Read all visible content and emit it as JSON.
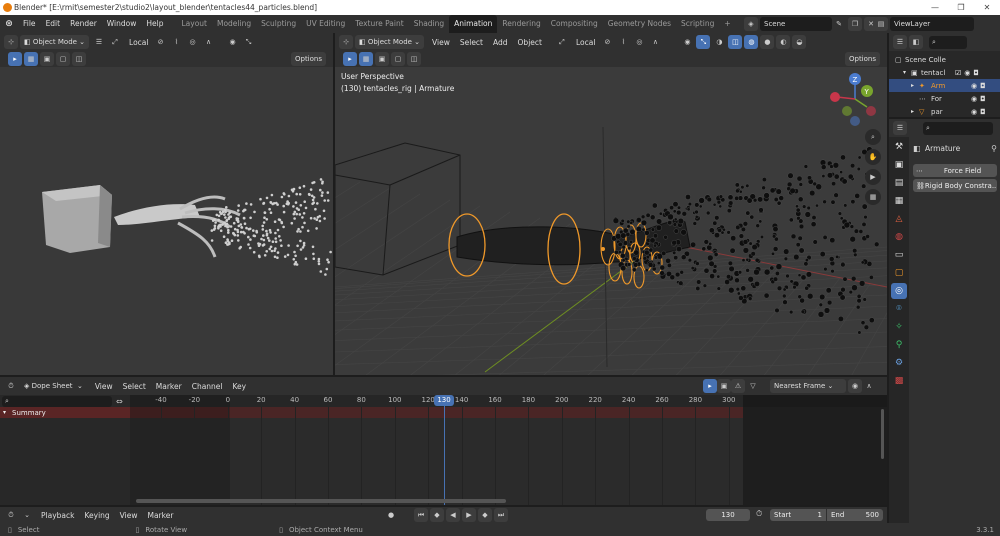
{
  "window": {
    "title": "Blender* [E:\\rmit\\semester2\\studio2\\layout_blender\\tentacles44_particles.blend]"
  },
  "menu": {
    "items": [
      "File",
      "Edit",
      "Render",
      "Window",
      "Help"
    ]
  },
  "workspaces": [
    "Layout",
    "Modeling",
    "Sculpting",
    "UV Editing",
    "Texture Paint",
    "Shading",
    "Animation",
    "Rendering",
    "Compositing",
    "Geometry Nodes",
    "Scripting"
  ],
  "active_workspace": "Animation",
  "scene": {
    "name": "Scene",
    "view_layer": "ViewLayer"
  },
  "left_viewport": {
    "mode": "Object Mode",
    "orientation": "Local",
    "options": "Options"
  },
  "main_viewport": {
    "mode": "Object Mode",
    "menu": [
      "View",
      "Select",
      "Add",
      "Object"
    ],
    "orientation": "Local",
    "options": "Options",
    "overlay_title": "User Perspective",
    "overlay_sub": "(130) tentacles_rig | Armature"
  },
  "outliner": {
    "rows": [
      {
        "label": "Scene Colle"
      },
      {
        "label": "tentacl"
      },
      {
        "label": "Arm"
      },
      {
        "label": "For"
      },
      {
        "label": "par"
      }
    ]
  },
  "properties": {
    "object_name": "Armature",
    "buttons": [
      "Force Field",
      "Rigid Body Constra..."
    ]
  },
  "dopesheet": {
    "editor": "Dope Sheet",
    "menu": [
      "View",
      "Select",
      "Marker",
      "Channel",
      "Key"
    ],
    "snap": "Nearest Frame",
    "channel": "Summary",
    "ticks": [
      "-40",
      "-20",
      "0",
      "20",
      "40",
      "60",
      "80",
      "100",
      "120",
      "140",
      "160",
      "180",
      "200",
      "220",
      "240",
      "260",
      "280",
      "300"
    ],
    "current_frame": "130"
  },
  "timeline": {
    "menu": [
      "Playback",
      "Keying",
      "View",
      "Marker"
    ],
    "frame": "130",
    "start_label": "Start",
    "start": "1",
    "end_label": "End",
    "end": "500"
  },
  "statusbar": {
    "select": "Select",
    "rotate": "Rotate View",
    "context": "Object Context Menu",
    "version": "3.3.1"
  },
  "colors": {
    "accent": "#4772b3",
    "selection_orange": "#f0992a",
    "bg_dark": "#1d1d1d",
    "header": "#303030"
  }
}
